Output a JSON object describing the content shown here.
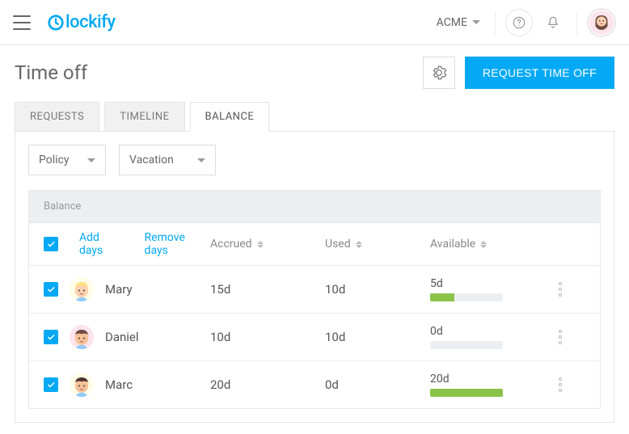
{
  "header": {
    "logo_text": "lockify",
    "workspace": "ACME"
  },
  "page": {
    "title": "Time off",
    "request_btn": "REQUEST TIME OFF"
  },
  "tabs": [
    {
      "label": "REQUESTS",
      "active": false
    },
    {
      "label": "TIMELINE",
      "active": false
    },
    {
      "label": "BALANCE",
      "active": true
    }
  ],
  "filters": {
    "policy_label": "Policy",
    "vacation_label": "Vacation"
  },
  "table": {
    "section_label": "Balance",
    "actions": {
      "add": "Add days",
      "remove": "Remove days"
    },
    "headers": {
      "accrued": "Accrued",
      "used": "Used",
      "available": "Available"
    },
    "rows": [
      {
        "name": "Mary",
        "accrued": "15d",
        "used": "10d",
        "available": "5d",
        "avail_pct": 33,
        "avatar_bg": "#fffde7",
        "hair": "#ffe082",
        "skin": "#fdd0b0"
      },
      {
        "name": "Daniel",
        "accrued": "10d",
        "used": "10d",
        "available": "0d",
        "avail_pct": 0,
        "avatar_bg": "#fce4ec",
        "hair": "#6d4c41",
        "skin": "#f5c29a"
      },
      {
        "name": "Marc",
        "accrued": "20d",
        "used": "0d",
        "available": "20d",
        "avail_pct": 100,
        "avatar_bg": "#fffde7",
        "hair": "#4e342e",
        "skin": "#f5c29a"
      }
    ]
  }
}
